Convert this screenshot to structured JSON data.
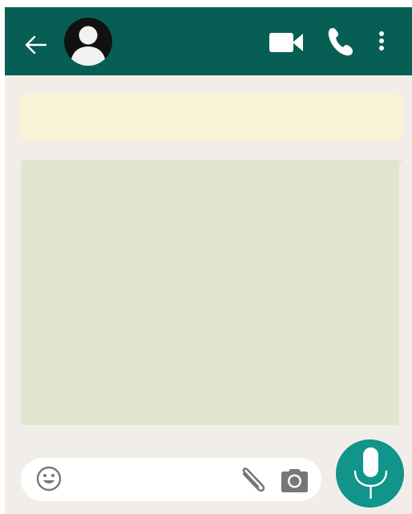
{
  "header": {
    "back_icon": "arrow-left-icon",
    "avatar_icon": "contact-avatar-icon",
    "actions": [
      "video-call-icon",
      "phone-icon",
      "more-vertical-icon"
    ]
  },
  "chat": {
    "notice_bubble": {
      "text": ""
    },
    "message_bubble": {
      "text": ""
    }
  },
  "composer": {
    "input_value": "",
    "input_placeholder": "",
    "emoji_icon": "emoji-icon",
    "attach_icon": "paperclip-icon",
    "camera_icon": "camera-icon",
    "mic_icon": "microphone-icon"
  },
  "colors": {
    "header_bg": "#075e54",
    "fab_bg": "#11948a",
    "chat_bg": "#f1eeea",
    "notice_bg": "#f9f2d6",
    "message_bg": "#e1e5d0"
  }
}
